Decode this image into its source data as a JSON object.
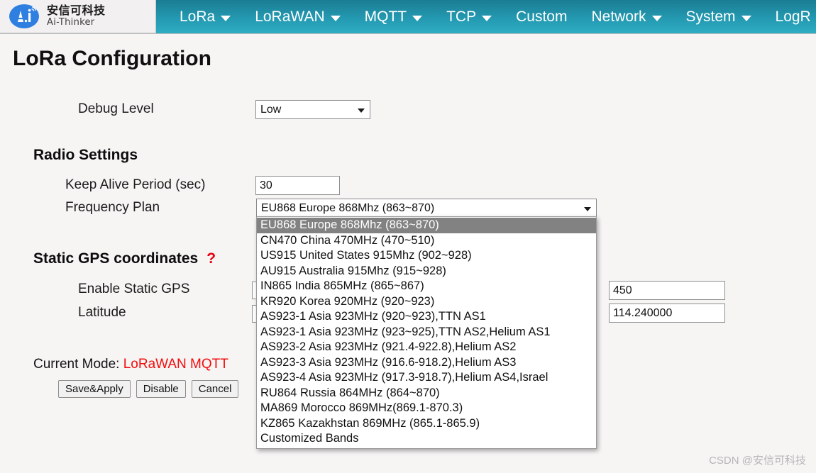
{
  "brand": {
    "logo_icon": "ai-thinker-logo-icon",
    "name_cn": "安信可科技",
    "name_en": "Ai-Thinker"
  },
  "nav": {
    "items": [
      {
        "label": "LoRa",
        "has_caret": true
      },
      {
        "label": "LoRaWAN",
        "has_caret": true
      },
      {
        "label": "MQTT",
        "has_caret": true
      },
      {
        "label": "TCP",
        "has_caret": true
      },
      {
        "label": "Custom",
        "has_caret": false
      },
      {
        "label": "Network",
        "has_caret": true
      },
      {
        "label": "System",
        "has_caret": true
      },
      {
        "label": "LogR",
        "has_caret": false
      }
    ]
  },
  "page": {
    "title": "LoRa Configuration"
  },
  "debug": {
    "label": "Debug Level",
    "value": "Low"
  },
  "radio": {
    "section_title": "Radio Settings",
    "keep_alive_label": "Keep Alive Period (sec)",
    "keep_alive_value": "30",
    "frequency_plan_label": "Frequency Plan",
    "frequency_plan_value": "EU868 Europe 868Mhz (863~870)"
  },
  "gps": {
    "section_title": "Static GPS coordinates",
    "help_mark": "?",
    "enable_label": "Enable Static GPS",
    "latitude_label": "Latitude",
    "altitude_value": "450",
    "longitude_value": "114.240000"
  },
  "frequency_options": [
    "EU868 Europe 868Mhz (863~870)",
    "CN470 China 470MHz (470~510)",
    "US915 United States 915Mhz (902~928)",
    "AU915 Australia 915Mhz (915~928)",
    "IN865 India 865MHz (865~867)",
    "KR920 Korea 920MHz (920~923)",
    "AS923-1 Asia 923MHz (920~923),TTN AS1",
    "AS923-1 Asia 923MHz (923~925),TTN AS2,Helium AS1",
    "AS923-2 Asia 923MHz (921.4-922.8),Helium AS2",
    "AS923-3 Asia 923MHz (916.6-918.2),Helium AS3",
    "AS923-4 Asia 923MHz (917.3-918.7),Helium AS4,Israel",
    "RU864 Russia 864MHz (864~870)",
    "MA869 Morocco 869MHz(869.1-870.3)",
    "KZ865 Kazakhstan 869MHz (865.1-865.9)",
    "Customized Bands"
  ],
  "selected_frequency_index": 0,
  "footer": {
    "mode_label": "Current Mode:",
    "mode_value": "LoRaWAN MQTT",
    "buttons": [
      "Save&Apply",
      "Disable",
      "Cancel"
    ]
  },
  "watermark": "CSDN @安信可科技",
  "colors": {
    "nav_top": "#1b7d93",
    "nav_bottom": "#2fadc2",
    "page_bg": "#f7f4f4",
    "accent_red": "#f10d0d",
    "help_red": "#e8000d",
    "option_highlight": "#828282"
  }
}
